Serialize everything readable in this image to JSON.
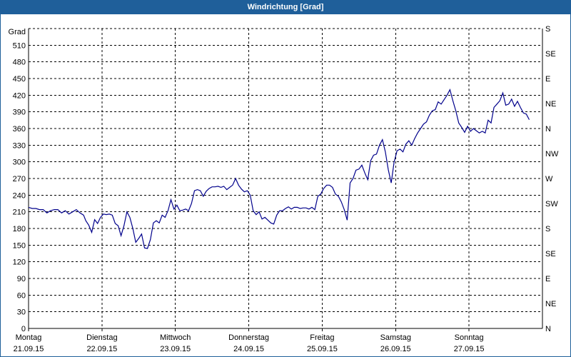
{
  "window": {
    "title": "Windrichtung [Grad]"
  },
  "chart_data": {
    "type": "line",
    "title": "Windrichtung [Grad]",
    "ylabel": "Grad",
    "ylim": [
      0,
      540
    ],
    "yticks": [
      0,
      30,
      60,
      90,
      120,
      150,
      180,
      210,
      240,
      270,
      300,
      330,
      360,
      390,
      420,
      450,
      480,
      510
    ],
    "y2_labels": [
      "N",
      "NE",
      "E",
      "SE",
      "S",
      "SW",
      "W",
      "NW",
      "N",
      "NE",
      "E",
      "SE",
      "S"
    ],
    "x_labels": [
      {
        "day": "Montag",
        "date": "21.09.15"
      },
      {
        "day": "Dienstag",
        "date": "22.09.15"
      },
      {
        "day": "Mittwoch",
        "date": "23.09.15"
      },
      {
        "day": "Donnerstag",
        "date": "24.09.15"
      },
      {
        "day": "Freitag",
        "date": "25.09.15"
      },
      {
        "day": "Samstag",
        "date": "26.09.15"
      },
      {
        "day": "Sonntag",
        "date": "27.09.15"
      }
    ],
    "grid": true,
    "series": [
      {
        "color": "#00008b",
        "points": [
          [
            0.0,
            218
          ],
          [
            0.05,
            216
          ],
          [
            0.1,
            216
          ],
          [
            0.15,
            214
          ],
          [
            0.2,
            214
          ],
          [
            0.25,
            208
          ],
          [
            0.3,
            212
          ],
          [
            0.35,
            214
          ],
          [
            0.4,
            214
          ],
          [
            0.45,
            208
          ],
          [
            0.5,
            212
          ],
          [
            0.55,
            206
          ],
          [
            0.6,
            210
          ],
          [
            0.65,
            214
          ],
          [
            0.7,
            208
          ],
          [
            0.75,
            204
          ],
          [
            0.78,
            194
          ],
          [
            0.82,
            186
          ],
          [
            0.86,
            173
          ],
          [
            0.9,
            196
          ],
          [
            0.94,
            189
          ],
          [
            0.98,
            200
          ],
          [
            1.02,
            206
          ],
          [
            1.06,
            205
          ],
          [
            1.1,
            206
          ],
          [
            1.14,
            204
          ],
          [
            1.18,
            189
          ],
          [
            1.22,
            185
          ],
          [
            1.26,
            167
          ],
          [
            1.3,
            185
          ],
          [
            1.34,
            210
          ],
          [
            1.38,
            200
          ],
          [
            1.42,
            180
          ],
          [
            1.46,
            155
          ],
          [
            1.5,
            162
          ],
          [
            1.54,
            170
          ],
          [
            1.58,
            145
          ],
          [
            1.62,
            144
          ],
          [
            1.66,
            160
          ],
          [
            1.7,
            190
          ],
          [
            1.74,
            194
          ],
          [
            1.78,
            190
          ],
          [
            1.82,
            204
          ],
          [
            1.86,
            200
          ],
          [
            1.9,
            212
          ],
          [
            1.94,
            232
          ],
          [
            1.98,
            215
          ],
          [
            2.02,
            222
          ],
          [
            2.06,
            212
          ],
          [
            2.1,
            213
          ],
          [
            2.14,
            215
          ],
          [
            2.18,
            212
          ],
          [
            2.22,
            225
          ],
          [
            2.26,
            248
          ],
          [
            2.3,
            250
          ],
          [
            2.34,
            248
          ],
          [
            2.38,
            238
          ],
          [
            2.42,
            247
          ],
          [
            2.46,
            252
          ],
          [
            2.5,
            255
          ],
          [
            2.54,
            255
          ],
          [
            2.58,
            256
          ],
          [
            2.62,
            254
          ],
          [
            2.66,
            256
          ],
          [
            2.7,
            250
          ],
          [
            2.74,
            254
          ],
          [
            2.78,
            258
          ],
          [
            2.82,
            270
          ],
          [
            2.86,
            258
          ],
          [
            2.9,
            251
          ],
          [
            2.94,
            246
          ],
          [
            2.98,
            248
          ],
          [
            3.02,
            240
          ],
          [
            3.06,
            212
          ],
          [
            3.1,
            205
          ],
          [
            3.14,
            210
          ],
          [
            3.18,
            197
          ],
          [
            3.22,
            200
          ],
          [
            3.26,
            195
          ],
          [
            3.3,
            190
          ],
          [
            3.34,
            188
          ],
          [
            3.38,
            204
          ],
          [
            3.42,
            212
          ],
          [
            3.46,
            212
          ],
          [
            3.5,
            216
          ],
          [
            3.54,
            219
          ],
          [
            3.58,
            215
          ],
          [
            3.62,
            218
          ],
          [
            3.66,
            218
          ],
          [
            3.7,
            216
          ],
          [
            3.74,
            217
          ],
          [
            3.78,
            217
          ],
          [
            3.82,
            215
          ],
          [
            3.86,
            218
          ],
          [
            3.9,
            214
          ],
          [
            3.94,
            238
          ],
          [
            3.98,
            242
          ],
          [
            4.02,
            252
          ],
          [
            4.06,
            258
          ],
          [
            4.1,
            258
          ],
          [
            4.14,
            254
          ],
          [
            4.18,
            242
          ],
          [
            4.22,
            238
          ],
          [
            4.26,
            228
          ],
          [
            4.3,
            214
          ],
          [
            4.34,
            195
          ],
          [
            4.38,
            262
          ],
          [
            4.42,
            270
          ],
          [
            4.46,
            285
          ],
          [
            4.5,
            287
          ],
          [
            4.54,
            294
          ],
          [
            4.58,
            280
          ],
          [
            4.62,
            268
          ],
          [
            4.66,
            302
          ],
          [
            4.7,
            312
          ],
          [
            4.74,
            314
          ],
          [
            4.78,
            330
          ],
          [
            4.82,
            340
          ],
          [
            4.86,
            318
          ],
          [
            4.9,
            286
          ],
          [
            4.94,
            262
          ],
          [
            4.98,
            300
          ],
          [
            5.02,
            320
          ],
          [
            5.06,
            323
          ],
          [
            5.1,
            318
          ],
          [
            5.14,
            332
          ],
          [
            5.18,
            338
          ],
          [
            5.22,
            330
          ],
          [
            5.26,
            342
          ],
          [
            5.3,
            352
          ],
          [
            5.34,
            360
          ],
          [
            5.38,
            368
          ],
          [
            5.42,
            372
          ],
          [
            5.46,
            384
          ],
          [
            5.5,
            392
          ],
          [
            5.54,
            394
          ],
          [
            5.58,
            408
          ],
          [
            5.62,
            404
          ],
          [
            5.66,
            412
          ],
          [
            5.7,
            420
          ],
          [
            5.74,
            430
          ],
          [
            5.78,
            410
          ],
          [
            5.82,
            392
          ],
          [
            5.86,
            370
          ],
          [
            5.9,
            362
          ],
          [
            5.94,
            353
          ],
          [
            5.98,
            364
          ],
          [
            6.02,
            355
          ],
          [
            6.06,
            360
          ],
          [
            6.1,
            356
          ],
          [
            6.14,
            352
          ],
          [
            6.18,
            355
          ],
          [
            6.22,
            352
          ],
          [
            6.26,
            375
          ],
          [
            6.3,
            370
          ],
          [
            6.34,
            398
          ],
          [
            6.38,
            404
          ],
          [
            6.42,
            410
          ],
          [
            6.46,
            424
          ],
          [
            6.5,
            402
          ],
          [
            6.54,
            404
          ],
          [
            6.58,
            413
          ],
          [
            6.62,
            400
          ],
          [
            6.66,
            409
          ],
          [
            6.7,
            398
          ],
          [
            6.74,
            388
          ],
          [
            6.78,
            386
          ],
          [
            6.82,
            376
          ]
        ]
      }
    ]
  }
}
